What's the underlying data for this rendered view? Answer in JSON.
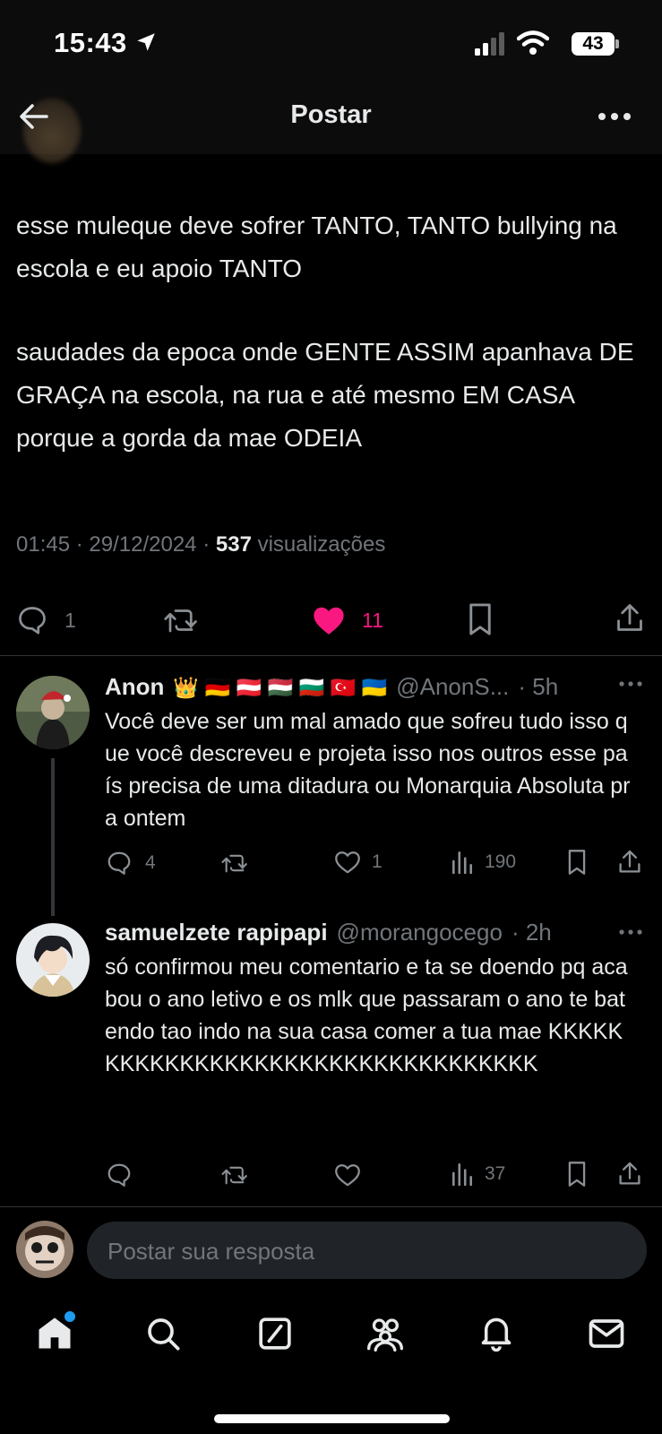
{
  "status_bar": {
    "time": "15:43",
    "battery": "43"
  },
  "header": {
    "title": "Postar"
  },
  "post": {
    "paragraphs": [
      "esse muleque deve sofrer TANTO, TANTO bullying na escola e eu apoio TANTO",
      "saudades da epoca onde GENTE ASSIM apanhava DE GRAÇA na escola, na rua e até mesmo EM CASA porque a gorda da mae ODEIA"
    ],
    "time": "01:45",
    "date": "29/12/2024",
    "views_count": "537",
    "views_label": "visualizações",
    "actions": {
      "replies": "1",
      "likes": "11"
    },
    "colors": {
      "like": "#f91880"
    }
  },
  "replies": [
    {
      "name": "Anon",
      "badges": "👑 🇩🇪 🇦🇹 🇭🇺 🇧🇬 🇹🇷 🇺🇦",
      "handle": "@AnonS...",
      "age": "· 5h",
      "text": "Você deve ser um mal amado que sofreu tudo isso que você descreveu e projeta isso nos outros esse país precisa de uma ditadura ou Monarquia Absoluta pra ontem",
      "replies": "4",
      "likes": "1",
      "views": "190"
    },
    {
      "name": "samuelzete rapipapi",
      "handle": "@morangocego",
      "age": "· 2h",
      "text": "só confirmou meu comentario e ta se doendo pq acabou o ano letivo e os mlk que passaram o ano te batendo tao indo na sua casa comer a tua mae KKKKKKKKKKKKKKKKKKKKKKKKKKKKKKKKKK",
      "views": "37"
    }
  ],
  "composer": {
    "placeholder": "Postar sua resposta"
  },
  "tabbar": {
    "icons": [
      "home-icon",
      "search-icon",
      "grok-icon",
      "communities-icon",
      "notifications-icon",
      "messages-icon"
    ],
    "accent": "#1d9bf0"
  }
}
